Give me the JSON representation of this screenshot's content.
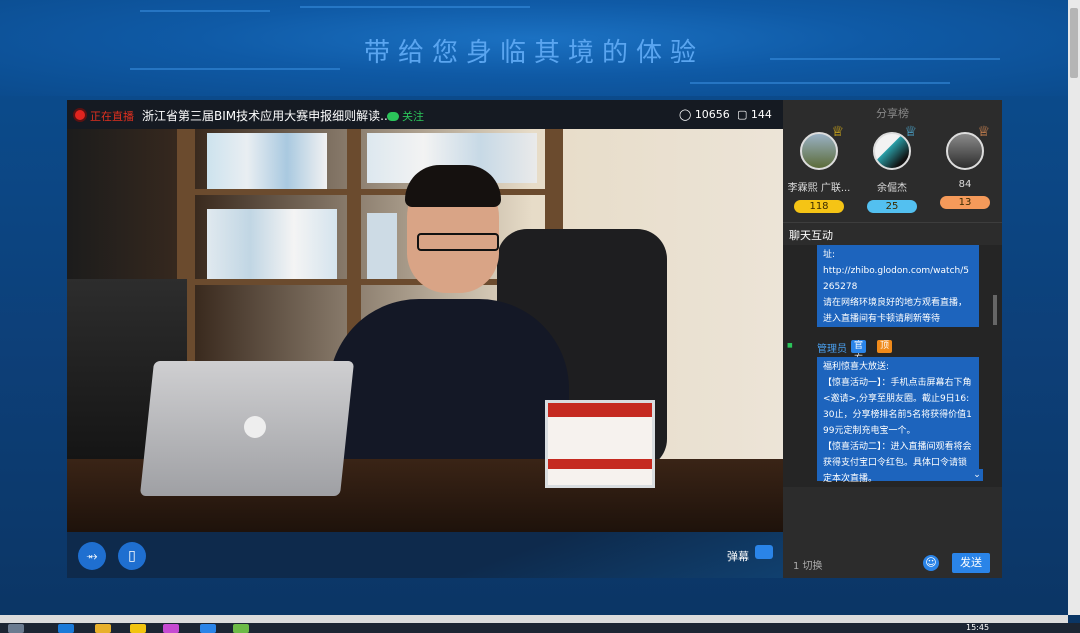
{
  "banner": {
    "slogan": "带给您身临其境的体验"
  },
  "player": {
    "live_label": "正在直播",
    "title": "浙江省第三届BIM技术应用大赛申报细则解读...",
    "follow_label": "关注",
    "viewer_count": "10656",
    "comment_count": "144",
    "danmu_label": "弹幕"
  },
  "sidebar": {
    "rank_title": "分享榜",
    "ranks": [
      {
        "name": "李霖熙 广联...",
        "score": "118",
        "color": "#f5c415"
      },
      {
        "name": "余倔杰",
        "score": "25",
        "color": "#53c0f0"
      },
      {
        "name": "84",
        "score": "13",
        "color": "#f59a5a"
      }
    ],
    "chat_title": "聊天互动",
    "messages": [
      {
        "text": "址:\nhttp://zhibo.glodon.com/watch/5265278\n请在网络环境良好的地方观看直播，进入直播间有卡顿请刷新等待"
      },
      {
        "text": "福利惊喜大放送:\n【惊喜活动一】：手机点击屏幕右下角<邀请>,分享至朋友圈。截止9日16:30止，分享榜排名前5名将获得价值199元定制充电宝一个。\n【惊喜活动二】：进入直播间观看将会获得支付宝口令红包。具体口令请锁定本次直播。"
      }
    ],
    "admin": {
      "name": "管理员",
      "badge_official": "官方",
      "badge_extra": "顶"
    },
    "switch_label": "1 切换",
    "send_label": "发送"
  },
  "taskbar": {
    "time": "15:45"
  }
}
